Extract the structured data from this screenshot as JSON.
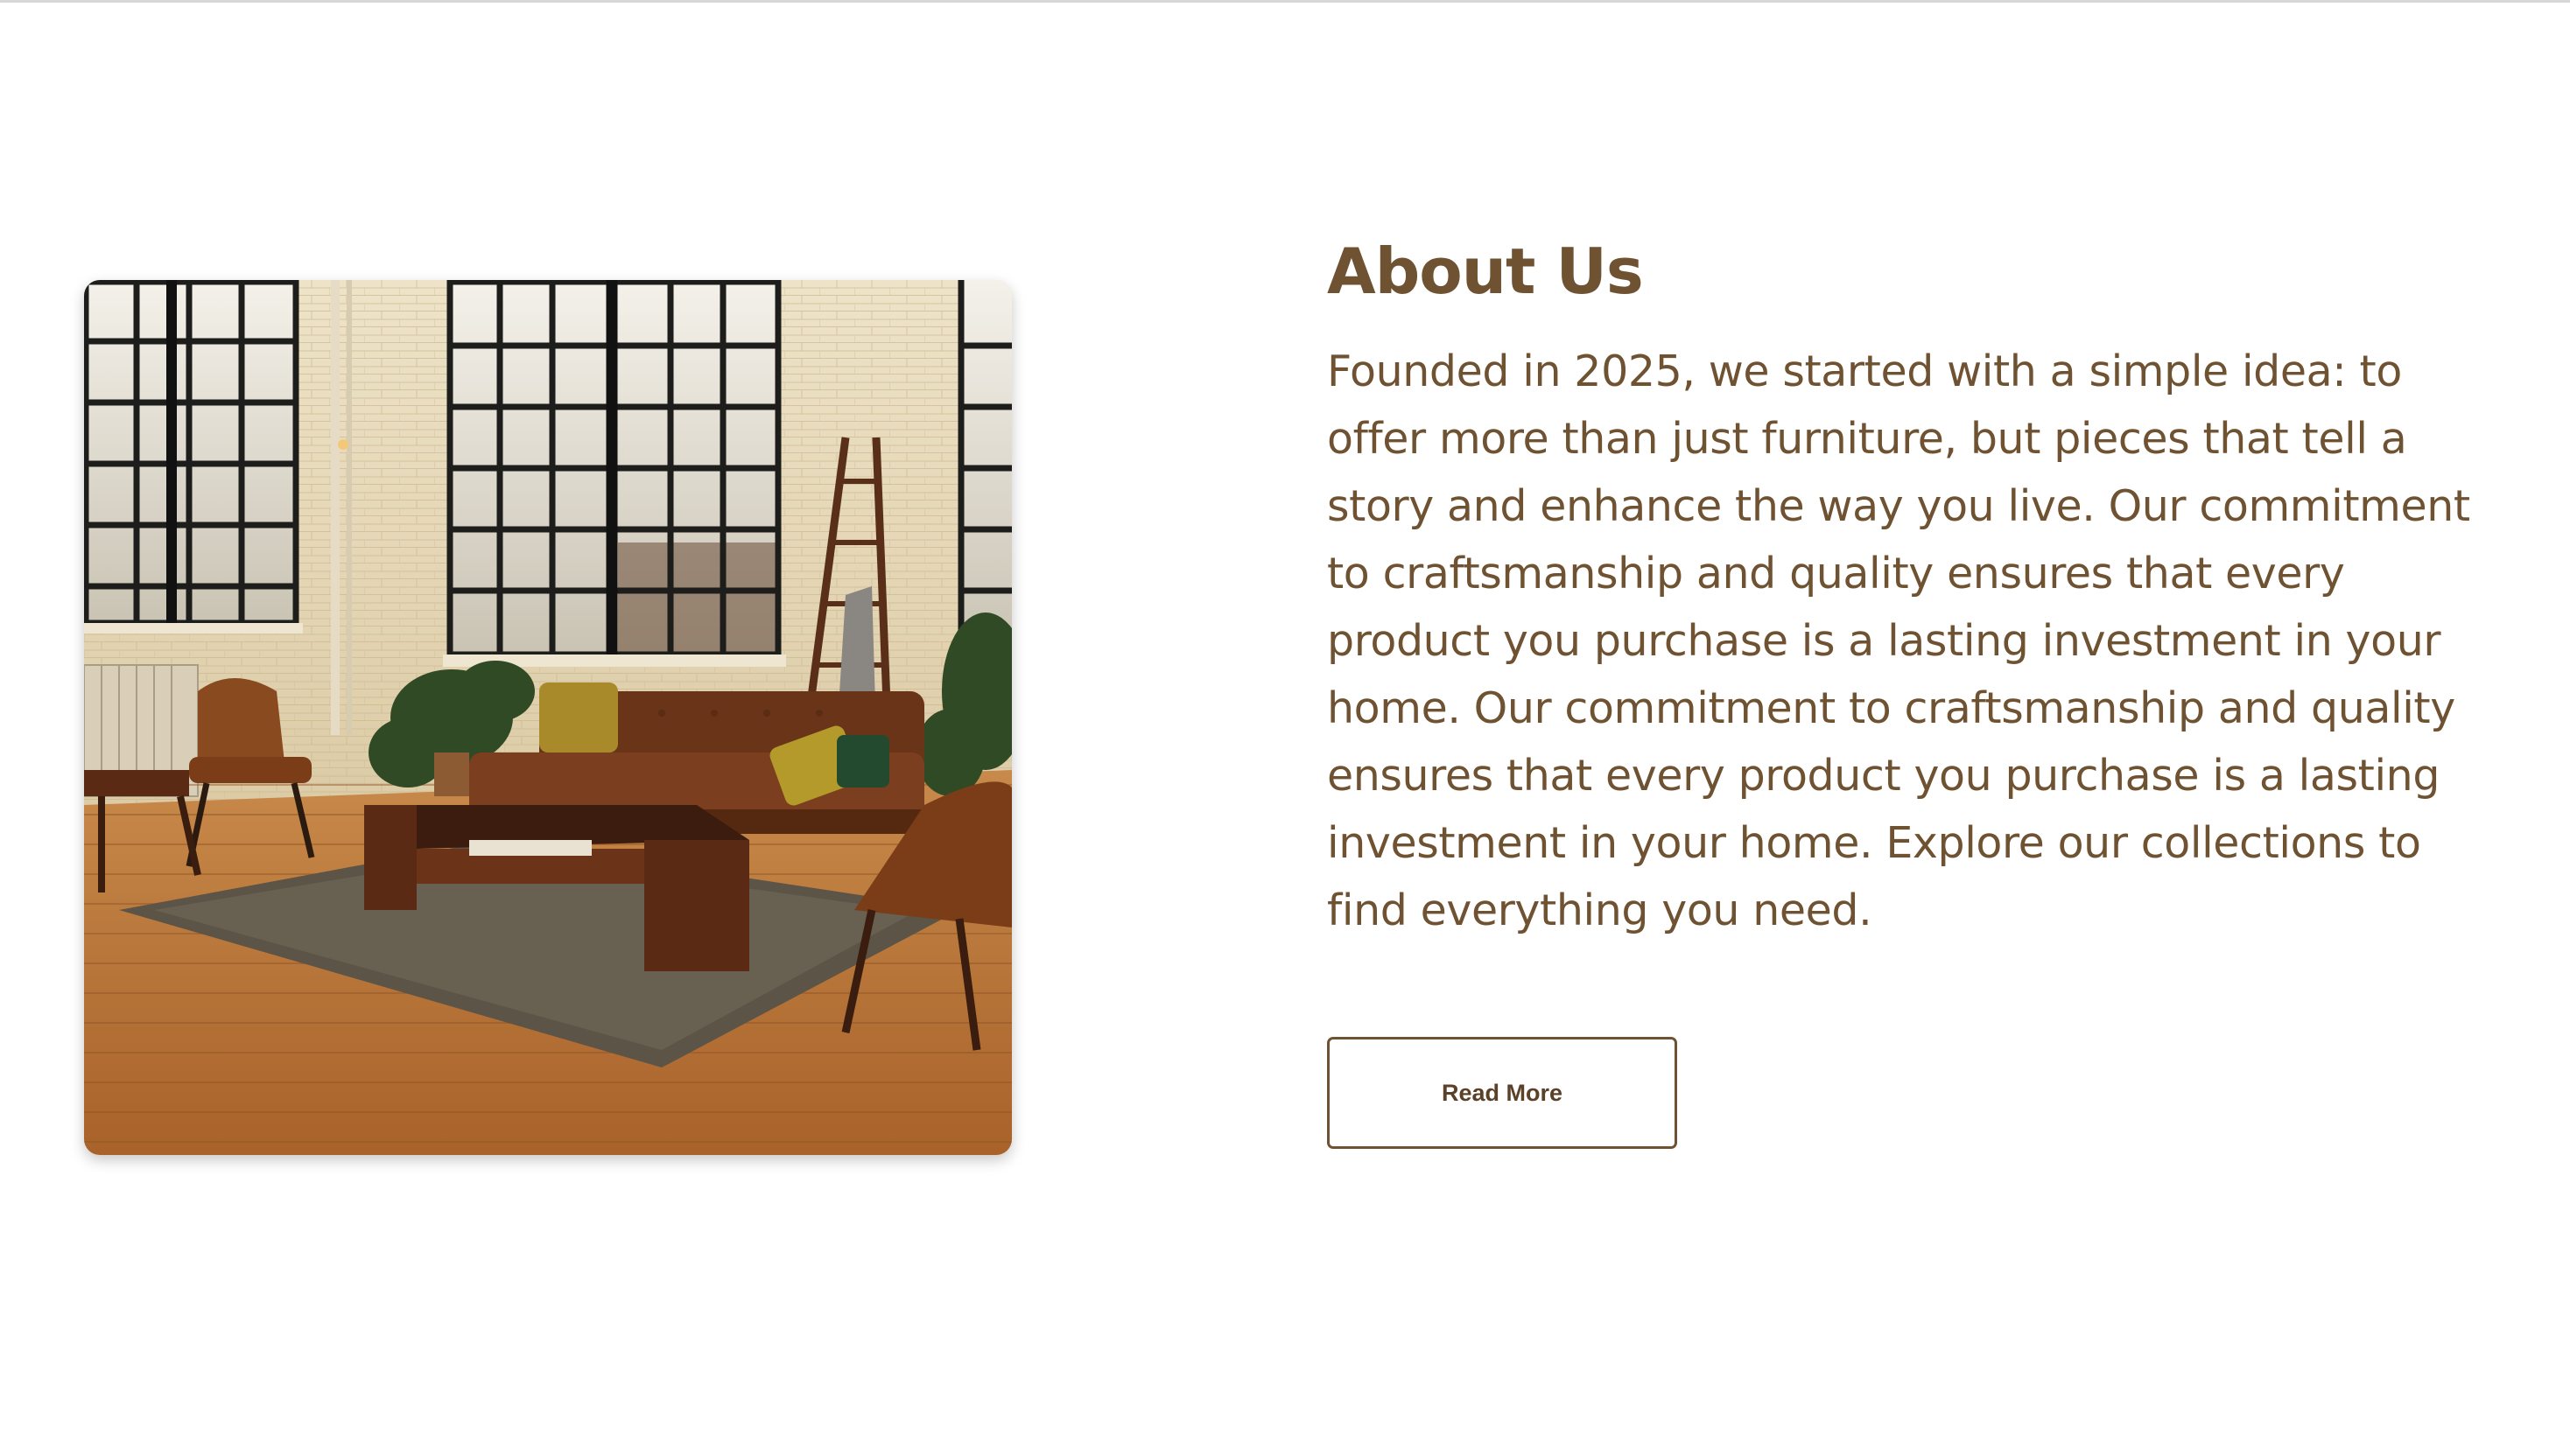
{
  "about": {
    "title": "About Us",
    "body": "Founded in 2025, we started with a simple idea: to offer more than just furniture, but pieces that tell a story and enhance the way you live. Our commitment to craftsmanship and quality ensures that every product you purchase is a lasting investment in your home. Our commitment to craftsmanship and quality ensures that every product you purchase is a lasting investment in your home. Explore our collections to find everything you need.",
    "button_label": "Read More"
  },
  "image": {
    "subject": "loft living room with large factory windows, brick walls, leather sofa, coffee table and rug"
  },
  "colors": {
    "text_brown": "#6f5232",
    "button_border": "#6f5232",
    "background": "#ffffff"
  }
}
